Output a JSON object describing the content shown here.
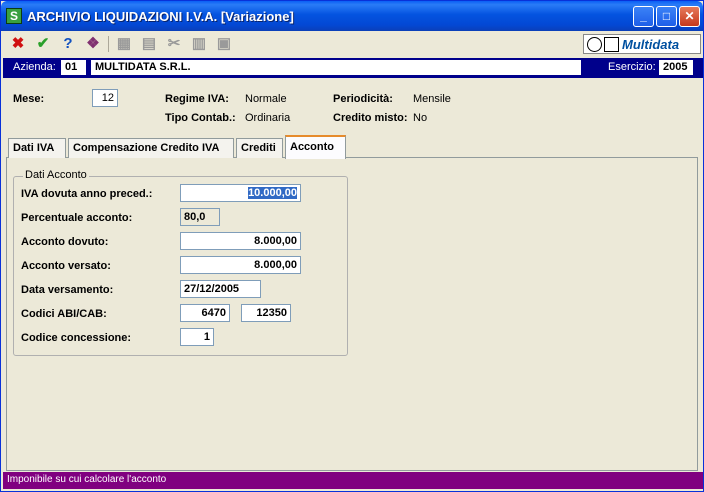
{
  "window": {
    "title": "ARCHIVIO LIQUIDAZIONI I.V.A. [Variazione]",
    "app_icon": "S",
    "minimize_icon": "_",
    "maximize_icon": "□",
    "close_icon": "✕"
  },
  "toolbar": {
    "cancel_icon": "✖",
    "confirm_icon": "✔",
    "help_icon": "?",
    "book_icon": "❖",
    "copy_icon": "▦",
    "edit_icon": "▤",
    "cut_icon": "✂",
    "paste_icon": "▥",
    "print_icon": "▣",
    "logo_text": "Multidata"
  },
  "azienda": {
    "label": "Azienda:",
    "code": "01",
    "name": "MULTIDATA S.R.L.",
    "esercizio_label": "Esercizio:",
    "esercizio": "2005"
  },
  "header": {
    "mese_label": "Mese:",
    "mese": "12",
    "regime_label": "Regime IVA:",
    "regime": "Normale",
    "tipo_label": "Tipo Contab.:",
    "tipo": "Ordinaria",
    "periodicita_label": "Periodicità:",
    "periodicita": "Mensile",
    "credito_label": "Credito misto:",
    "credito": "No"
  },
  "tabs": [
    {
      "label": "Dati IVA"
    },
    {
      "label": "Compensazione Credito IVA"
    },
    {
      "label": "Crediti"
    },
    {
      "label": "Acconto"
    }
  ],
  "acconto": {
    "group_title": "Dati Acconto",
    "iva_dovuta_label": "IVA dovuta anno preced.:",
    "iva_dovuta": "10.000,00",
    "percentuale_label": "Percentuale acconto:",
    "percentuale": "80,0",
    "acconto_dovuto_label": "Acconto dovuto:",
    "acconto_dovuto": "8.000,00",
    "acconto_versato_label": "Acconto versato:",
    "acconto_versato": "8.000,00",
    "data_label": "Data versamento:",
    "data": "27/12/2005",
    "abi_cab_label": "Codici ABI/CAB:",
    "abi": "6470",
    "cab": "12350",
    "concessione_label": "Codice concessione:",
    "concessione": "1"
  },
  "status": {
    "text": "Imponibile su cui calcolare l'acconto"
  },
  "colors": {
    "azienda_bar": "#00008b",
    "status_bar": "#800080",
    "selection": "#316ac5"
  }
}
